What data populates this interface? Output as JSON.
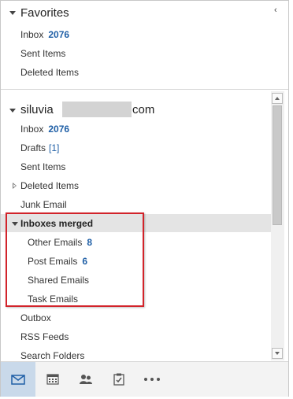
{
  "favorites": {
    "title": "Favorites",
    "items": [
      {
        "label": "Inbox",
        "count": "2076"
      },
      {
        "label": "Sent Items"
      },
      {
        "label": "Deleted Items"
      }
    ]
  },
  "account": {
    "name_prefix": "siluvia",
    "name_suffix": "com",
    "items": [
      {
        "label": "Inbox",
        "count": "2076"
      },
      {
        "label": "Drafts",
        "bracket": "[1]"
      },
      {
        "label": "Sent Items"
      },
      {
        "label": "Deleted Items"
      },
      {
        "label": "Junk Email"
      }
    ],
    "group": {
      "label": "Inboxes merged",
      "items": [
        {
          "label": "Other Emails",
          "count": "8"
        },
        {
          "label": "Post Emails",
          "count": "6"
        },
        {
          "label": "Shared Emails"
        },
        {
          "label": "Task Emails"
        }
      ]
    },
    "more_items": [
      {
        "label": "Outbox"
      },
      {
        "label": "RSS Feeds"
      },
      {
        "label": "Search Folders"
      }
    ]
  },
  "bottom_nav": {
    "items": [
      {
        "icon": "mail-icon",
        "active": true
      },
      {
        "icon": "calendar-icon"
      },
      {
        "icon": "people-icon"
      },
      {
        "icon": "tasks-icon"
      },
      {
        "icon": "more-icon"
      }
    ]
  },
  "colors": {
    "count": "#1f5fa6",
    "highlight_box": "#d2232a",
    "active_nav": "#c9d9ea"
  }
}
